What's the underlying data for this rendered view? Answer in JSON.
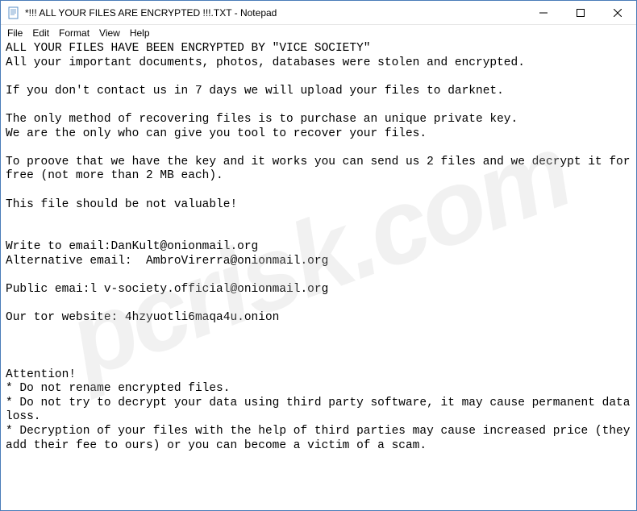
{
  "window": {
    "title": "*!!! ALL YOUR FILES ARE ENCRYPTED !!!.TXT - Notepad"
  },
  "menu": {
    "file": "File",
    "edit": "Edit",
    "format": "Format",
    "view": "View",
    "help": "Help"
  },
  "body": {
    "text": "ALL YOUR FILES HAVE BEEN ENCRYPTED BY \"VICE SOCIETY\"\nAll your important documents, photos, databases were stolen and encrypted.\n\nIf you don't contact us in 7 days we will upload your files to darknet.\n\nThe only method of recovering files is to purchase an unique private key.\nWe are the only who can give you tool to recover your files.\n\nTo proove that we have the key and it works you can send us 2 files and we decrypt it for free (not more than 2 MB each).\n\nThis file should be not valuable!\n\n\nWrite to email:DanKult@onionmail.org\nAlternative email:  AmbroVirerra@onionmail.org\n\nPublic emai:l v-society.official@onionmail.org\n\nOur tor website: 4hzyuotli6maqa4u.onion\n\n\n\nAttention!\n* Do not rename encrypted files.\n* Do not try to decrypt your data using third party software, it may cause permanent data loss.\n* Decryption of your files with the help of third parties may cause increased price (they add their fee to ours) or you can become a victim of a scam."
  },
  "watermark": {
    "text": "pcrisk.com"
  }
}
